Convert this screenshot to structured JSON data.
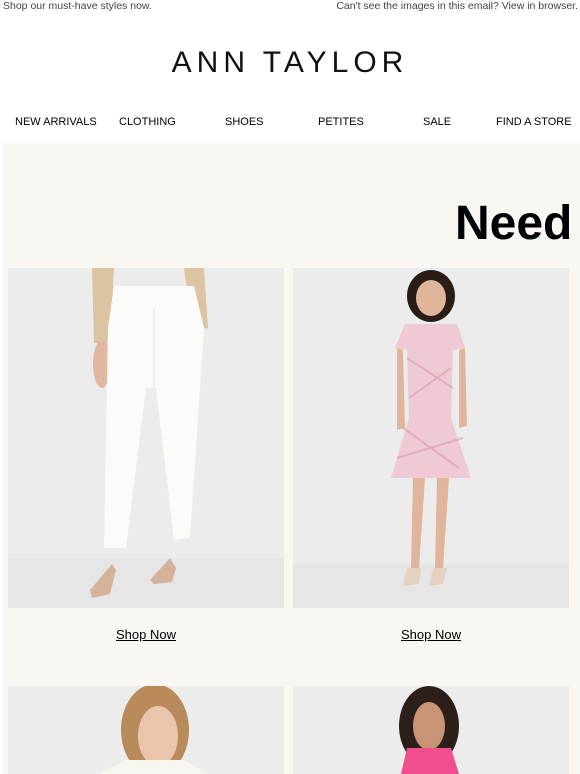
{
  "preheader": {
    "left_text": "Shop our must-have styles now.",
    "right_text": "Can't see the images in this email? View in browser."
  },
  "brand": {
    "logo_text": "ANN TAYLOR"
  },
  "nav": {
    "items": [
      "NEW ARRIVALS",
      "CLOTHING",
      "SHOES",
      "PETITES",
      "SALE",
      "FIND A STORE"
    ]
  },
  "hero": {
    "headline": "Need"
  },
  "products": [
    {
      "shop_label": "Shop Now",
      "image": "white-trousers"
    },
    {
      "shop_label": "Shop Now",
      "image": "pink-tweed-dress"
    },
    {
      "image": "white-blazer-model"
    },
    {
      "image": "pink-top-model"
    }
  ],
  "colors": {
    "panel_bg": "#faf6f1",
    "tile_bg": "#eaeaea"
  }
}
